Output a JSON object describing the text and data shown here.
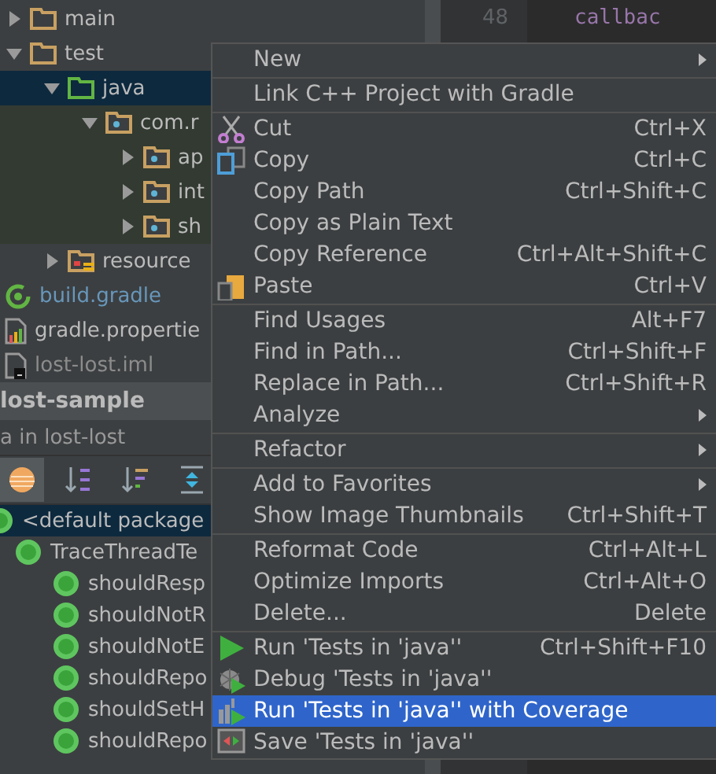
{
  "project_tree": [
    {
      "label": "main",
      "kind": "folder",
      "expanded": false,
      "selected": false
    },
    {
      "label": "test",
      "kind": "folder",
      "expanded": true,
      "selected": false,
      "children": [
        {
          "label": "java",
          "kind": "test-folder",
          "expanded": true,
          "selected": true,
          "children": [
            {
              "label": "com.r",
              "kind": "package",
              "expanded": true,
              "selected": false,
              "children": [
                {
                  "label": "ap",
                  "kind": "package",
                  "expanded": false,
                  "selected": false
                },
                {
                  "label": "int",
                  "kind": "package",
                  "expanded": false,
                  "selected": false
                },
                {
                  "label": "sh",
                  "kind": "package",
                  "expanded": false,
                  "selected": false
                }
              ]
            }
          ]
        },
        {
          "label": "resource",
          "kind": "resources",
          "expanded": false,
          "selected": false
        }
      ]
    },
    {
      "label": "build.gradle",
      "kind": "gradle",
      "selected": false
    },
    {
      "label": "gradle.propertie",
      "kind": "properties",
      "selected": false
    },
    {
      "label": "lost-lost.iml",
      "kind": "iml",
      "selected": false
    }
  ],
  "run_panel": {
    "title": "lost-sample",
    "subtitle": "a in lost-lost",
    "toolbar": [
      {
        "kind": "circle",
        "pressed": true
      },
      {
        "kind": "sort-alpha",
        "pressed": false
      },
      {
        "kind": "sort-duration",
        "pressed": false
      },
      {
        "kind": "expand",
        "pressed": false
      }
    ],
    "tests": [
      {
        "label": "<default package",
        "kind": "passed",
        "selected": true,
        "children": [
          {
            "label": "TraceThreadTe",
            "kind": "passed",
            "selected": false,
            "children": [
              {
                "label": "shouldResp",
                "kind": "passed",
                "selected": false
              },
              {
                "label": "shouldNotR",
                "kind": "passed",
                "selected": false
              },
              {
                "label": "shouldNotE",
                "kind": "passed",
                "selected": false
              },
              {
                "label": "shouldRepo",
                "kind": "passed",
                "selected": false
              },
              {
                "label": "shouldSetH",
                "kind": "passed",
                "selected": false
              },
              {
                "label": "shouldRepo",
                "kind": "passed",
                "selected": false
              }
            ]
          }
        ]
      }
    ]
  },
  "editor": {
    "lines": [
      {
        "number": "48",
        "code": "callbac"
      }
    ]
  },
  "context_menu": {
    "groups": [
      [
        {
          "label": "New",
          "submenu": true,
          "selected": false
        }
      ],
      [
        {
          "label": "Link C++ Project with Gradle",
          "selected": false
        }
      ],
      [
        {
          "label": "Cut",
          "shortcut": "Ctrl+X",
          "kind": "scissors",
          "selected": false
        },
        {
          "label": "Copy",
          "shortcut": "Ctrl+C",
          "kind": "copy",
          "selected": false
        },
        {
          "label": "Copy Path",
          "shortcut": "Ctrl+Shift+C",
          "selected": false
        },
        {
          "label": "Copy as Plain Text",
          "selected": false
        },
        {
          "label": "Copy Reference",
          "shortcut": "Ctrl+Alt+Shift+C",
          "selected": false
        },
        {
          "label": "Paste",
          "shortcut": "Ctrl+V",
          "kind": "paste",
          "selected": false
        }
      ],
      [
        {
          "label": "Find Usages",
          "shortcut": "Alt+F7",
          "selected": false
        },
        {
          "label": "Find in Path...",
          "shortcut": "Ctrl+Shift+F",
          "selected": false
        },
        {
          "label": "Replace in Path...",
          "shortcut": "Ctrl+Shift+R",
          "selected": false
        },
        {
          "label": "Analyze",
          "submenu": true,
          "selected": false
        }
      ],
      [
        {
          "label": "Refactor",
          "submenu": true,
          "selected": false
        }
      ],
      [
        {
          "label": "Add to Favorites",
          "submenu": true,
          "selected": false
        },
        {
          "label": "Show Image Thumbnails",
          "shortcut": "Ctrl+Shift+T",
          "selected": false
        }
      ],
      [
        {
          "label": "Reformat Code",
          "shortcut": "Ctrl+Alt+L",
          "selected": false
        },
        {
          "label": "Optimize Imports",
          "shortcut": "Ctrl+Alt+O",
          "selected": false
        },
        {
          "label": "Delete...",
          "shortcut": "Delete",
          "selected": false
        }
      ],
      [
        {
          "label": "Run 'Tests in 'java''",
          "shortcut": "Ctrl+Shift+F10",
          "kind": "run",
          "selected": false
        },
        {
          "label": "Debug 'Tests in 'java''",
          "kind": "debug",
          "selected": false
        },
        {
          "label": "Run 'Tests in 'java'' with Coverage",
          "kind": "coverage",
          "selected": true
        },
        {
          "label": "Save 'Tests in 'java''",
          "kind": "save",
          "selected": false
        }
      ]
    ]
  }
}
